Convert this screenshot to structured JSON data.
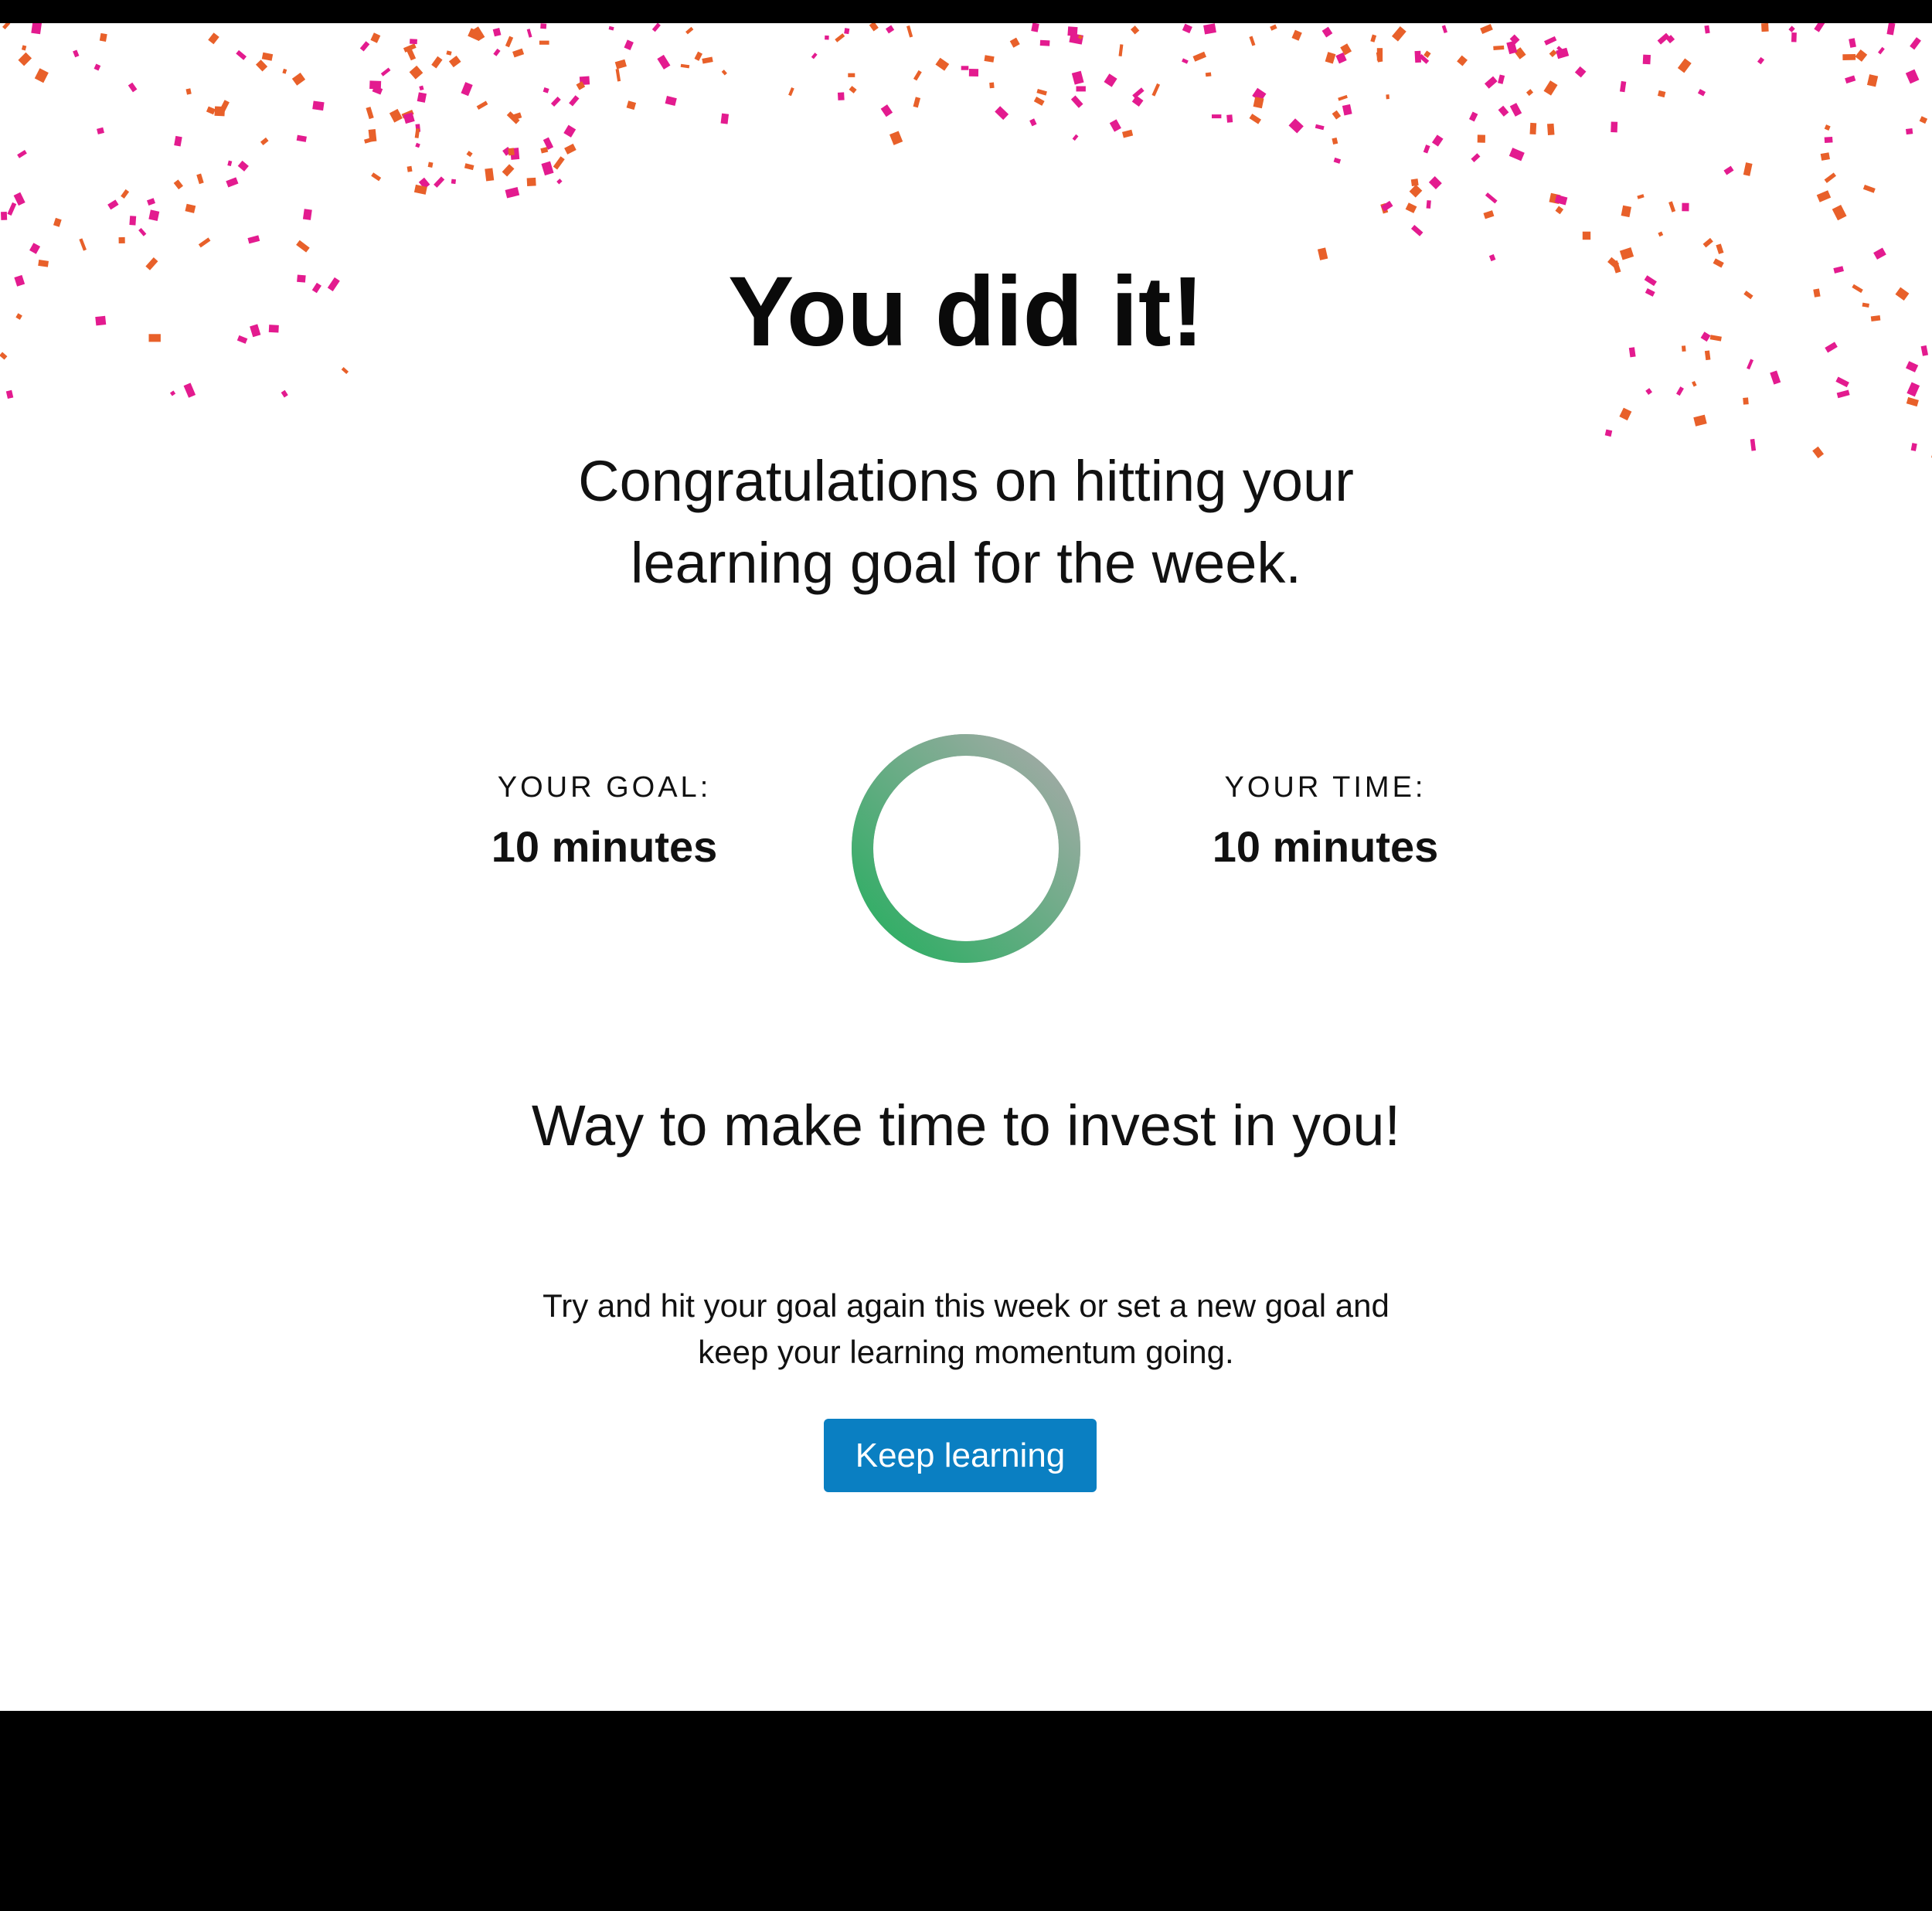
{
  "celebration": {
    "headline": "You did it!",
    "subhead_line1": "Congratulations on hitting your",
    "subhead_line2": "learning goal for the week.",
    "motivation": "Way to make time to invest in you!",
    "hint_line1": "Try and hit your goal again this week or set a new goal and",
    "hint_line2": "keep your learning momentum going."
  },
  "stats": {
    "goal_label": "YOUR GOAL:",
    "goal_value": "10 minutes",
    "time_label": "YOUR TIME:",
    "time_value": "10 minutes"
  },
  "progress": {
    "fraction": 1.0,
    "color_start": "#27ae60",
    "color_end": "#a8aaa9"
  },
  "actions": {
    "keep_learning_label": "Keep learning",
    "button_color": "#0a7fc2"
  },
  "colors": {
    "confetti_orange": "#e8602a",
    "confetti_pink": "#e31b8f",
    "background": "#ffffff",
    "frame": "#000000"
  }
}
